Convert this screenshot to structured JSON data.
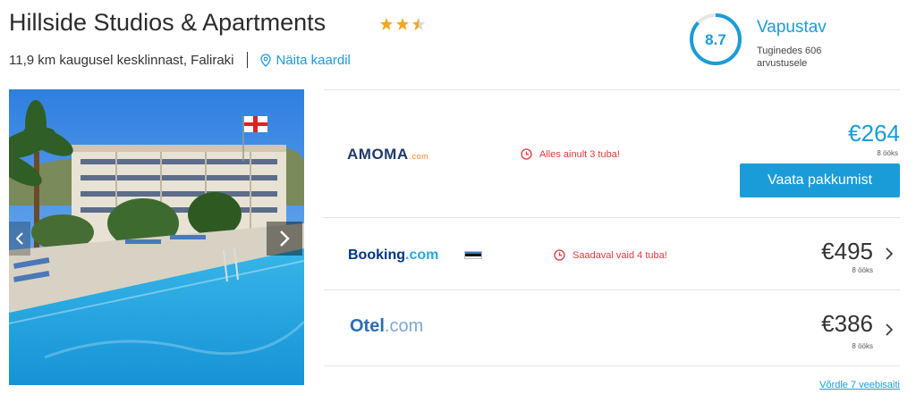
{
  "hotel": {
    "name": "Hillside Studios & Apartments",
    "star_rating": 3.5,
    "distance": "11,9 km kaugusel kesklinnast, Faliraki",
    "map_link": "Näita kaardil"
  },
  "rating": {
    "score": "8.7",
    "word": "Vapustav",
    "reviews": "Tuginedes 606 arvustusele",
    "fill_fraction": 0.87
  },
  "offers": [
    {
      "provider": "AMOMA",
      "provider_suffix": ".com",
      "availability": "Alles ainult 3 tuba!",
      "price": "€264",
      "nights": "8 ööks",
      "cta": "Vaata pakkumist"
    },
    {
      "provider": "Booking",
      "provider_suffix": ".com",
      "availability": "Saadaval vaid 4 tuba!",
      "price": "€495",
      "nights": "8 ööks"
    },
    {
      "provider": "Otel",
      "provider_suffix": ".com",
      "price": "€386",
      "nights": "8 ööks"
    }
  ],
  "compare_link": "Võrdle 7 veebisaiti",
  "colors": {
    "accent": "#1a9cd8",
    "alert": "#e0393e",
    "star": "#f5a623"
  },
  "icons": [
    "star-icon",
    "map-pin-icon",
    "clock-icon",
    "chevron-right-icon",
    "chevron-left-icon",
    "flag-estonia-icon"
  ]
}
